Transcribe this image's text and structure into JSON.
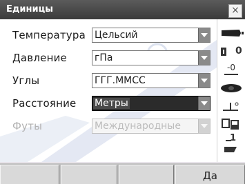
{
  "window": {
    "title": "Единицы",
    "close_label": "×"
  },
  "form": {
    "rows": [
      {
        "label": "Температура",
        "value": "Цельсий",
        "state": "normal"
      },
      {
        "label": "Давление",
        "value": "гПа",
        "state": "normal"
      },
      {
        "label": "Углы",
        "value": "ГГГ.ММСС",
        "state": "normal"
      },
      {
        "label": "Расстояние",
        "value": "Метры",
        "state": "selected"
      },
      {
        "label": "Футы",
        "value": "Международные",
        "state": "disabled"
      }
    ]
  },
  "status": {
    "icons": [
      "battery-icon",
      "target-prism-icon",
      "offset-icon",
      "compensator-icon",
      "face-icon",
      "memory-icon",
      "page-icon"
    ],
    "prism_const_label": "0",
    "offset_label": "-0",
    "page_label": "1"
  },
  "softkeys": {
    "keys": [
      "",
      "",
      "",
      "Да"
    ]
  },
  "colors": {
    "titlebar": "#3a3a3a",
    "selected_field": "#2b2b2b",
    "watermark": "#3d5fa8"
  }
}
